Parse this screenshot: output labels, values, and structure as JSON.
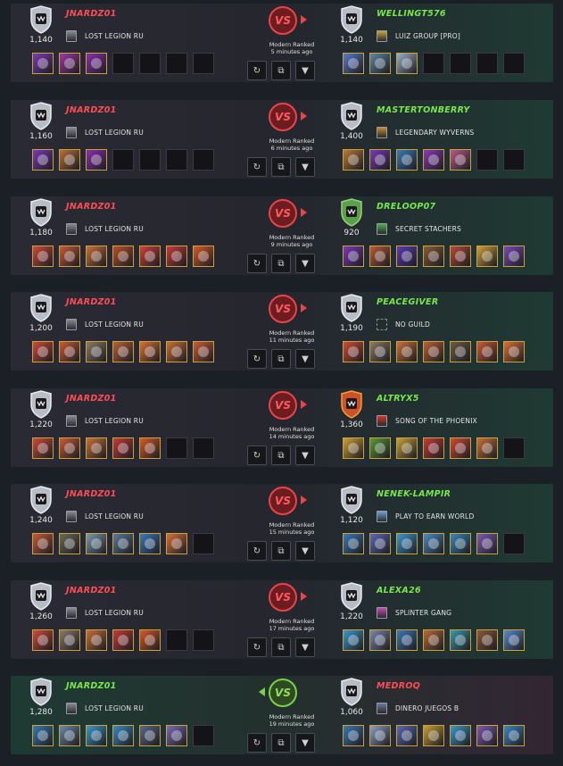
{
  "battles": [
    {
      "result": "loss",
      "vs_label": "VS",
      "mode_line1": "Modern Ranked",
      "time_ago": "5 minutes ago",
      "left": {
        "name": "JNARDZ01",
        "rating": "1,140",
        "guild": "LOST LEGION RU",
        "guild_icon": "#8a8a92",
        "league": "silver",
        "cards": [
          "#7b3ab8",
          "#9b3aa8",
          "#8a2fb0",
          "",
          "",
          "",
          ""
        ]
      },
      "right": {
        "name": "WELLINGT576",
        "rating": "1,140",
        "guild": "LUIZ GROUP [PRO]",
        "guild_icon": "#c9a23a",
        "league": "silver",
        "cards": [
          "#5a7bd0",
          "#5a88a8",
          "#9ab0c8",
          "",
          "",
          "",
          ""
        ]
      }
    },
    {
      "result": "loss",
      "vs_label": "VS",
      "mode_line1": "Modern Ranked",
      "time_ago": "6 minutes ago",
      "left": {
        "name": "JNARDZ01",
        "rating": "1,160",
        "guild": "LOST LEGION RU",
        "guild_icon": "#8a8a92",
        "league": "silver",
        "cards": [
          "#7b3ab8",
          "#b8703a",
          "#8a2fb0",
          "",
          "",
          "",
          ""
        ]
      },
      "right": {
        "name": "MASTERTONBERRY",
        "rating": "1,400",
        "guild": "LEGENDARY WYVERNS",
        "guild_icon": "#c98a2a",
        "league": "silver",
        "cards": [
          "#b87a3a",
          "#7a3ab8",
          "#3a7ab8",
          "#8a3ab8",
          "#b85a8a",
          "",
          ""
        ]
      }
    },
    {
      "result": "loss",
      "vs_label": "VS",
      "mode_line1": "Modern Ranked",
      "time_ago": "9 minutes ago",
      "left": {
        "name": "JNARDZ01",
        "rating": "1,180",
        "guild": "LOST LEGION RU",
        "guild_icon": "#8a8a92",
        "league": "silver",
        "cards": [
          "#d04a3a",
          "#c85a3a",
          "#c8703a",
          "#b8502a",
          "#d0403a",
          "#c83a3a",
          "#d85a2a"
        ]
      },
      "right": {
        "name": "DRELOOP07",
        "rating": "920",
        "guild": "SECRET STACHERS",
        "guild_icon": "#4ab04a",
        "league": "bronze",
        "cards": [
          "#7a3ab8",
          "#b85a3a",
          "#5a3ab8",
          "#8a5a3a",
          "#b84a3a",
          "#d0a03a",
          "#7a4ab8"
        ]
      }
    },
    {
      "result": "loss",
      "vs_label": "VS",
      "mode_line1": "Modern Ranked",
      "time_ago": "11 minutes ago",
      "left": {
        "name": "JNARDZ01",
        "rating": "1,200",
        "guild": "LOST LEGION RU",
        "guild_icon": "#8a8a92",
        "league": "silver",
        "cards": [
          "#d04a3a",
          "#c85a3a",
          "#8a7a6a",
          "#b8603a",
          "#d8703a",
          "#c8703a",
          "#c85a3a"
        ]
      },
      "right": {
        "name": "PEACEGIVER",
        "rating": "1,190",
        "guild": "NO GUILD",
        "guild_icon": "",
        "league": "silver",
        "cards": [
          "#d04a3a",
          "#8a7a6a",
          "#c8703a",
          "#b8603a",
          "#6a5a4a",
          "#c85a3a",
          "#d8703a"
        ]
      }
    },
    {
      "result": "loss",
      "vs_label": "VS",
      "mode_line1": "Modern Ranked",
      "time_ago": "14 minutes ago",
      "left": {
        "name": "JNARDZ01",
        "rating": "1,220",
        "guild": "LOST LEGION RU",
        "guild_icon": "#8a8a92",
        "league": "silver",
        "cards": [
          "#d04a3a",
          "#c85a3a",
          "#c8703a",
          "#c83a3a",
          "#d85a2a",
          "",
          ""
        ]
      },
      "right": {
        "name": "ALTRYX5",
        "rating": "1,360",
        "guild": "SONG OF THE PHOENIX",
        "guild_icon": "#d03a2a",
        "league": "gold",
        "cards": [
          "#d0a03a",
          "#5a9a3a",
          "#c8a03a",
          "#c83a3a",
          "#d04a3a",
          "#c8703a",
          ""
        ]
      }
    },
    {
      "result": "loss",
      "vs_label": "VS",
      "mode_line1": "Modern Ranked",
      "time_ago": "15 minutes ago",
      "left": {
        "name": "JNARDZ01",
        "rating": "1,240",
        "guild": "LOST LEGION RU",
        "guild_icon": "#8a8a92",
        "league": "silver",
        "cards": [
          "#c85a3a",
          "#6a6a5a",
          "#7a9ab0",
          "#5a7a9a",
          "#3a7ab8",
          "#d8703a",
          ""
        ]
      },
      "right": {
        "name": "NENEK-LAMPIR",
        "rating": "1,120",
        "guild": "PLAY TO EARN WORLD",
        "guild_icon": "#6aa0d0",
        "league": "silver",
        "cards": [
          "#3a7ab8",
          "#5a6ab8",
          "#3a9ad0",
          "#4a8ac8",
          "#3a8ab8",
          "#7a5ab8",
          ""
        ]
      }
    },
    {
      "result": "loss",
      "vs_label": "VS",
      "mode_line1": "Modern Ranked",
      "time_ago": "17 minutes ago",
      "left": {
        "name": "JNARDZ01",
        "rating": "1,260",
        "guild": "LOST LEGION RU",
        "guild_icon": "#8a8a92",
        "league": "silver",
        "cards": [
          "#d04a3a",
          "#8a7a6a",
          "#c8703a",
          "#c83a3a",
          "#d85a2a",
          "",
          ""
        ]
      },
      "right": {
        "name": "ALEXA26",
        "rating": "1,220",
        "guild": "SPLINTER GANG",
        "guild_icon": "#c84ab8",
        "league": "silver",
        "cards": [
          "#3a9ad0",
          "#7a8ab0",
          "#3a7ab8",
          "#b86a3a",
          "#3a9ab0",
          "#8a5a3a",
          "#5a8ad0"
        ]
      }
    },
    {
      "result": "win",
      "vs_label": "VS",
      "mode_line1": "Modern Ranked",
      "time_ago": "19 minutes ago",
      "left": {
        "name": "JNARDZ01",
        "rating": "1,280",
        "guild": "LOST LEGION RU",
        "guild_icon": "#8a8a92",
        "league": "silver",
        "cards": [
          "#3a7ab8",
          "#6a8ab0",
          "#3a9ad0",
          "#3a8ac8",
          "#5a6a8a",
          "#7a6ab8",
          ""
        ]
      },
      "right": {
        "name": "MEDROQ",
        "rating": "1,060",
        "guild": "DINERO JUEGOS B",
        "guild_icon": "#6a7a9a",
        "league": "silver",
        "cards": [
          "#3a7ab8",
          "#8aa0c8",
          "#5a6ab8",
          "#c8a03a",
          "#3a9ad0",
          "#7a5ab8",
          "#3a8ac8"
        ]
      }
    }
  ]
}
